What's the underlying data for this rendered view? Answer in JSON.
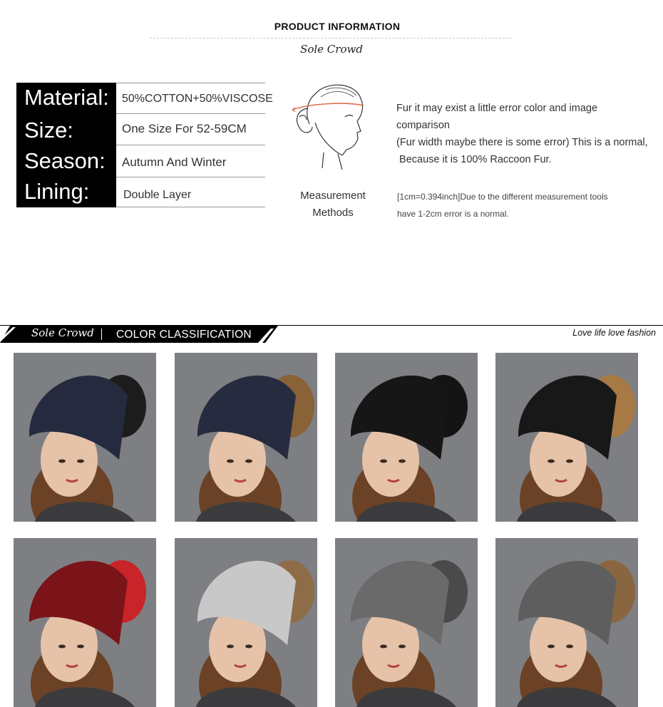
{
  "header": {
    "title": "PRODUCT INFORMATION",
    "brand": "Sole Crowd"
  },
  "specs": [
    {
      "key": "Material:",
      "value": "50%COTTON+50%VISCOSE"
    },
    {
      "key": "Size:",
      "value": "One Size For 52-59CM"
    },
    {
      "key": "Season:",
      "value": "Autumn And Winter"
    },
    {
      "key": "Lining:",
      "value": "Double Layer"
    }
  ],
  "measurement": {
    "label_line1": "Measurement",
    "label_line2": "Methods",
    "fur_note": [
      "Fur it may exist a little error color and image comparison",
      "(Fur width maybe there is some error) This is a normal,",
      " Because it is 100% Raccoon Fur."
    ],
    "note": [
      "[1cm=0.394inch]Due to the different measurement tools",
      "have 1-2cm error is a normal."
    ]
  },
  "banner": {
    "brand": "Sole Crowd",
    "title": "COLOR CLASSIFICATION",
    "tagline": "Love life  love fashion"
  },
  "products": [
    {
      "hat_color": "#252a3f",
      "pom_color": "#1c1c1c"
    },
    {
      "hat_color": "#262b40",
      "pom_color": "#8a6238"
    },
    {
      "hat_color": "#161616",
      "pom_color": "#141414"
    },
    {
      "hat_color": "#181818",
      "pom_color": "#a77a45"
    },
    {
      "hat_color": "#7a1418",
      "pom_color": "#c8242a"
    },
    {
      "hat_color": "#c8c8c8",
      "pom_color": "#8f6c48"
    },
    {
      "hat_color": "#6a6a6a",
      "pom_color": "#4a4a4a"
    },
    {
      "hat_color": "#5e5e5e",
      "pom_color": "#8a6640"
    }
  ]
}
